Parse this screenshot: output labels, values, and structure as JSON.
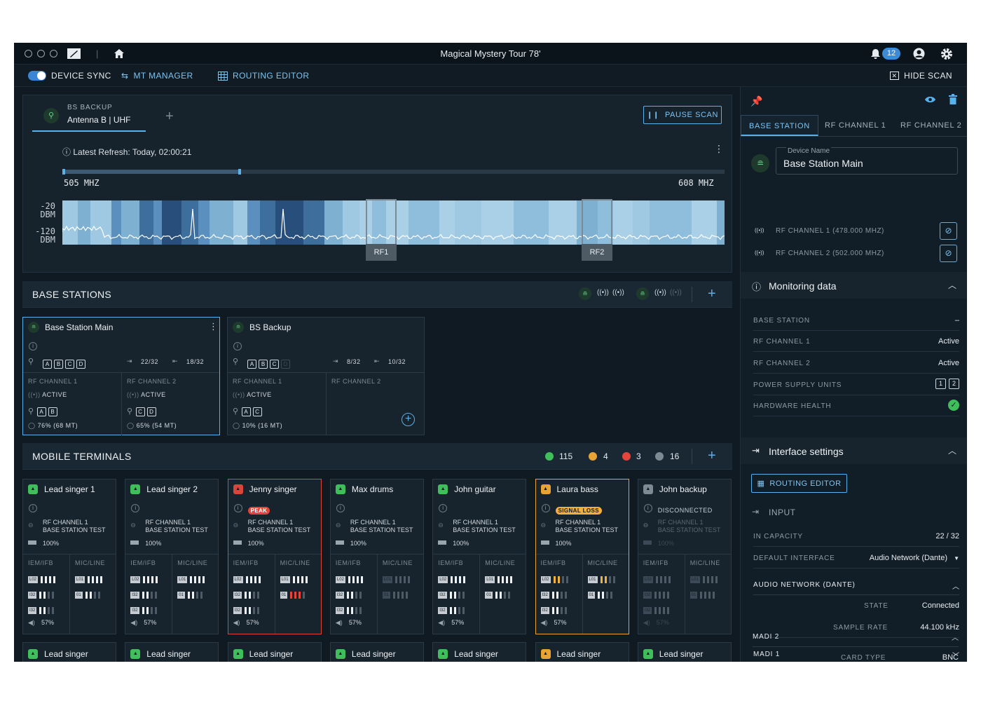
{
  "window": {
    "title": "Magical Mystery Tour 78'",
    "notifications": "12"
  },
  "menu": {
    "device_sync": "DEVICE SYNC",
    "mt_manager": "MT MANAGER",
    "routing_editor": "ROUTING EDITOR",
    "hide_scan": "HIDE SCAN"
  },
  "scan": {
    "tab_small": "BS BACKUP",
    "tab_main": "Antenna B | UHF",
    "pause": "PAUSE SCAN",
    "refresh": "Latest Refresh: Today, 02:00:21",
    "freq_lo": "505 MHZ",
    "freq_hi": "608 MHZ",
    "dbm_top": [
      "-20",
      "DBM"
    ],
    "dbm_bottom": [
      "-120",
      "DBM"
    ],
    "rf1": "RF1",
    "rf2": "RF2",
    "range_fraction": [
      0.0,
      0.27
    ]
  },
  "base_stations": {
    "title": "BASE STATIONS",
    "cards": [
      {
        "name": "Base Station Main",
        "letters": [
          "A",
          "B",
          "C",
          "D"
        ],
        "in_cap": "22/32",
        "out_cap": "18/32",
        "ch1_label": "RF CHANNEL 1",
        "ch1_status": "ACTIVE",
        "ch1_ant": [
          "A",
          "B"
        ],
        "ch1_load": "76% (68 MT)",
        "ch2_label": "RF CHANNEL 2",
        "ch2_status": "ACTIVE",
        "ch2_ant": [
          "C",
          "D"
        ],
        "ch2_load": "65% (54 MT)"
      },
      {
        "name": "BS Backup",
        "letters": [
          "A",
          "B",
          "C",
          "D"
        ],
        "in_cap": "8/32",
        "out_cap": "10/32",
        "ch1_label": "RF CHANNEL 1",
        "ch1_status": "ACTIVE",
        "ch1_ant": [
          "A",
          "C"
        ],
        "ch1_load": "10% (16 MT)",
        "ch2_label": "RF CHANNEL 2"
      }
    ]
  },
  "mobile_terminals": {
    "title": "MOBILE TERMINALS",
    "counts": {
      "green": "115",
      "orange": "4",
      "red": "3",
      "grey": "16"
    },
    "cards": [
      {
        "name": "Lead singer 1",
        "status": "",
        "ch": "RF CHANNEL 1",
        "bs": "BASE STATION TEST",
        "battery": "100%",
        "volume": "57%",
        "state": "ok"
      },
      {
        "name": "Lead singer 2",
        "status": "",
        "ch": "RF CHANNEL 1",
        "bs": "BASE STATION TEST",
        "battery": "100%",
        "volume": "57%",
        "state": "ok"
      },
      {
        "name": "Jenny singer",
        "status": "PEAK",
        "ch": "RF CHANNEL 1",
        "bs": "BASE STATION TEST",
        "battery": "100%",
        "volume": "57%",
        "state": "peak"
      },
      {
        "name": "Max drums",
        "status": "",
        "ch": "RF CHANNEL 1",
        "bs": "BASE STATION TEST",
        "battery": "100%",
        "volume": "57%",
        "state": "ok2"
      },
      {
        "name": "John guitar",
        "status": "",
        "ch": "RF CHANNEL 1",
        "bs": "BASE STATION TEST",
        "battery": "100%",
        "volume": "57%",
        "state": "ok"
      },
      {
        "name": "Laura bass",
        "status": "SIGNAL LOSS",
        "ch": "RF CHANNEL 1",
        "bs": "BASE STATION TEST",
        "battery": "100%",
        "volume": "57%",
        "state": "signal"
      },
      {
        "name": "John backup",
        "status": "DISCONNECTED",
        "ch": "RF CHANNEL 1",
        "bs": "BASE STATION TEST",
        "battery": "100%",
        "volume": "57%",
        "state": "off"
      }
    ],
    "col_iem": "IEM/IFB",
    "col_mic": "MIC/LINE",
    "peek_name": "Lead singer"
  },
  "right": {
    "tabs": [
      "BASE STATION",
      "RF CHANNEL 1",
      "RF CHANNEL 2"
    ],
    "device_name_label": "Device Name",
    "device_name": "Base Station Main",
    "rf1": "RF CHANNEL 1 (478.000 MHZ)",
    "rf2": "RF CHANNEL 2 (502.000 MHZ)",
    "monitoring": {
      "title": "Monitoring data",
      "rows": [
        {
          "k": "BASE STATION",
          "v": "–"
        },
        {
          "k": "RF CHANNEL 1",
          "v": "Active"
        },
        {
          "k": "RF CHANNEL 2",
          "v": "Active"
        },
        {
          "k": "POWER SUPPLY UNITS",
          "v": ""
        },
        {
          "k": "HARDWARE HEALTH",
          "v": ""
        }
      ],
      "psu": [
        "1",
        "2"
      ]
    },
    "interface": {
      "title": "Interface settings",
      "routing_btn": "ROUTING EDITOR",
      "input": "INPUT",
      "in_capacity_k": "IN CAPACITY",
      "in_capacity_v": "22 / 32",
      "default_interface_k": "DEFAULT INTERFACE",
      "default_interface_v": "Audio Network (Dante)",
      "dante": "AUDIO NETWORK (DANTE)",
      "state_k": "STATE",
      "state_v": "Connected",
      "sample_k": "SAMPLE RATE",
      "sample_v": "44.100 kHz",
      "madi1": "MADI 1",
      "madi2": "MADI 2",
      "card_k": "CARD TYPE",
      "card_v": "BNC"
    }
  },
  "colors": {
    "accent": "#5ab0e8",
    "green": "#3fbf5a",
    "orange": "#e8a333",
    "red": "#e5443a",
    "grey": "#7d8a94"
  }
}
